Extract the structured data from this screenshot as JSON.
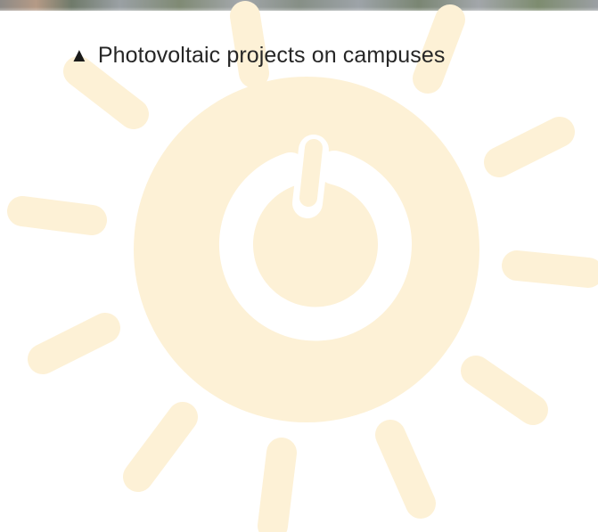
{
  "caption": {
    "marker": "▲",
    "text": "Photovoltaic projects on campuses"
  },
  "watermark": {
    "icon": "sun-power-icon",
    "color": "#fdf1d6"
  }
}
